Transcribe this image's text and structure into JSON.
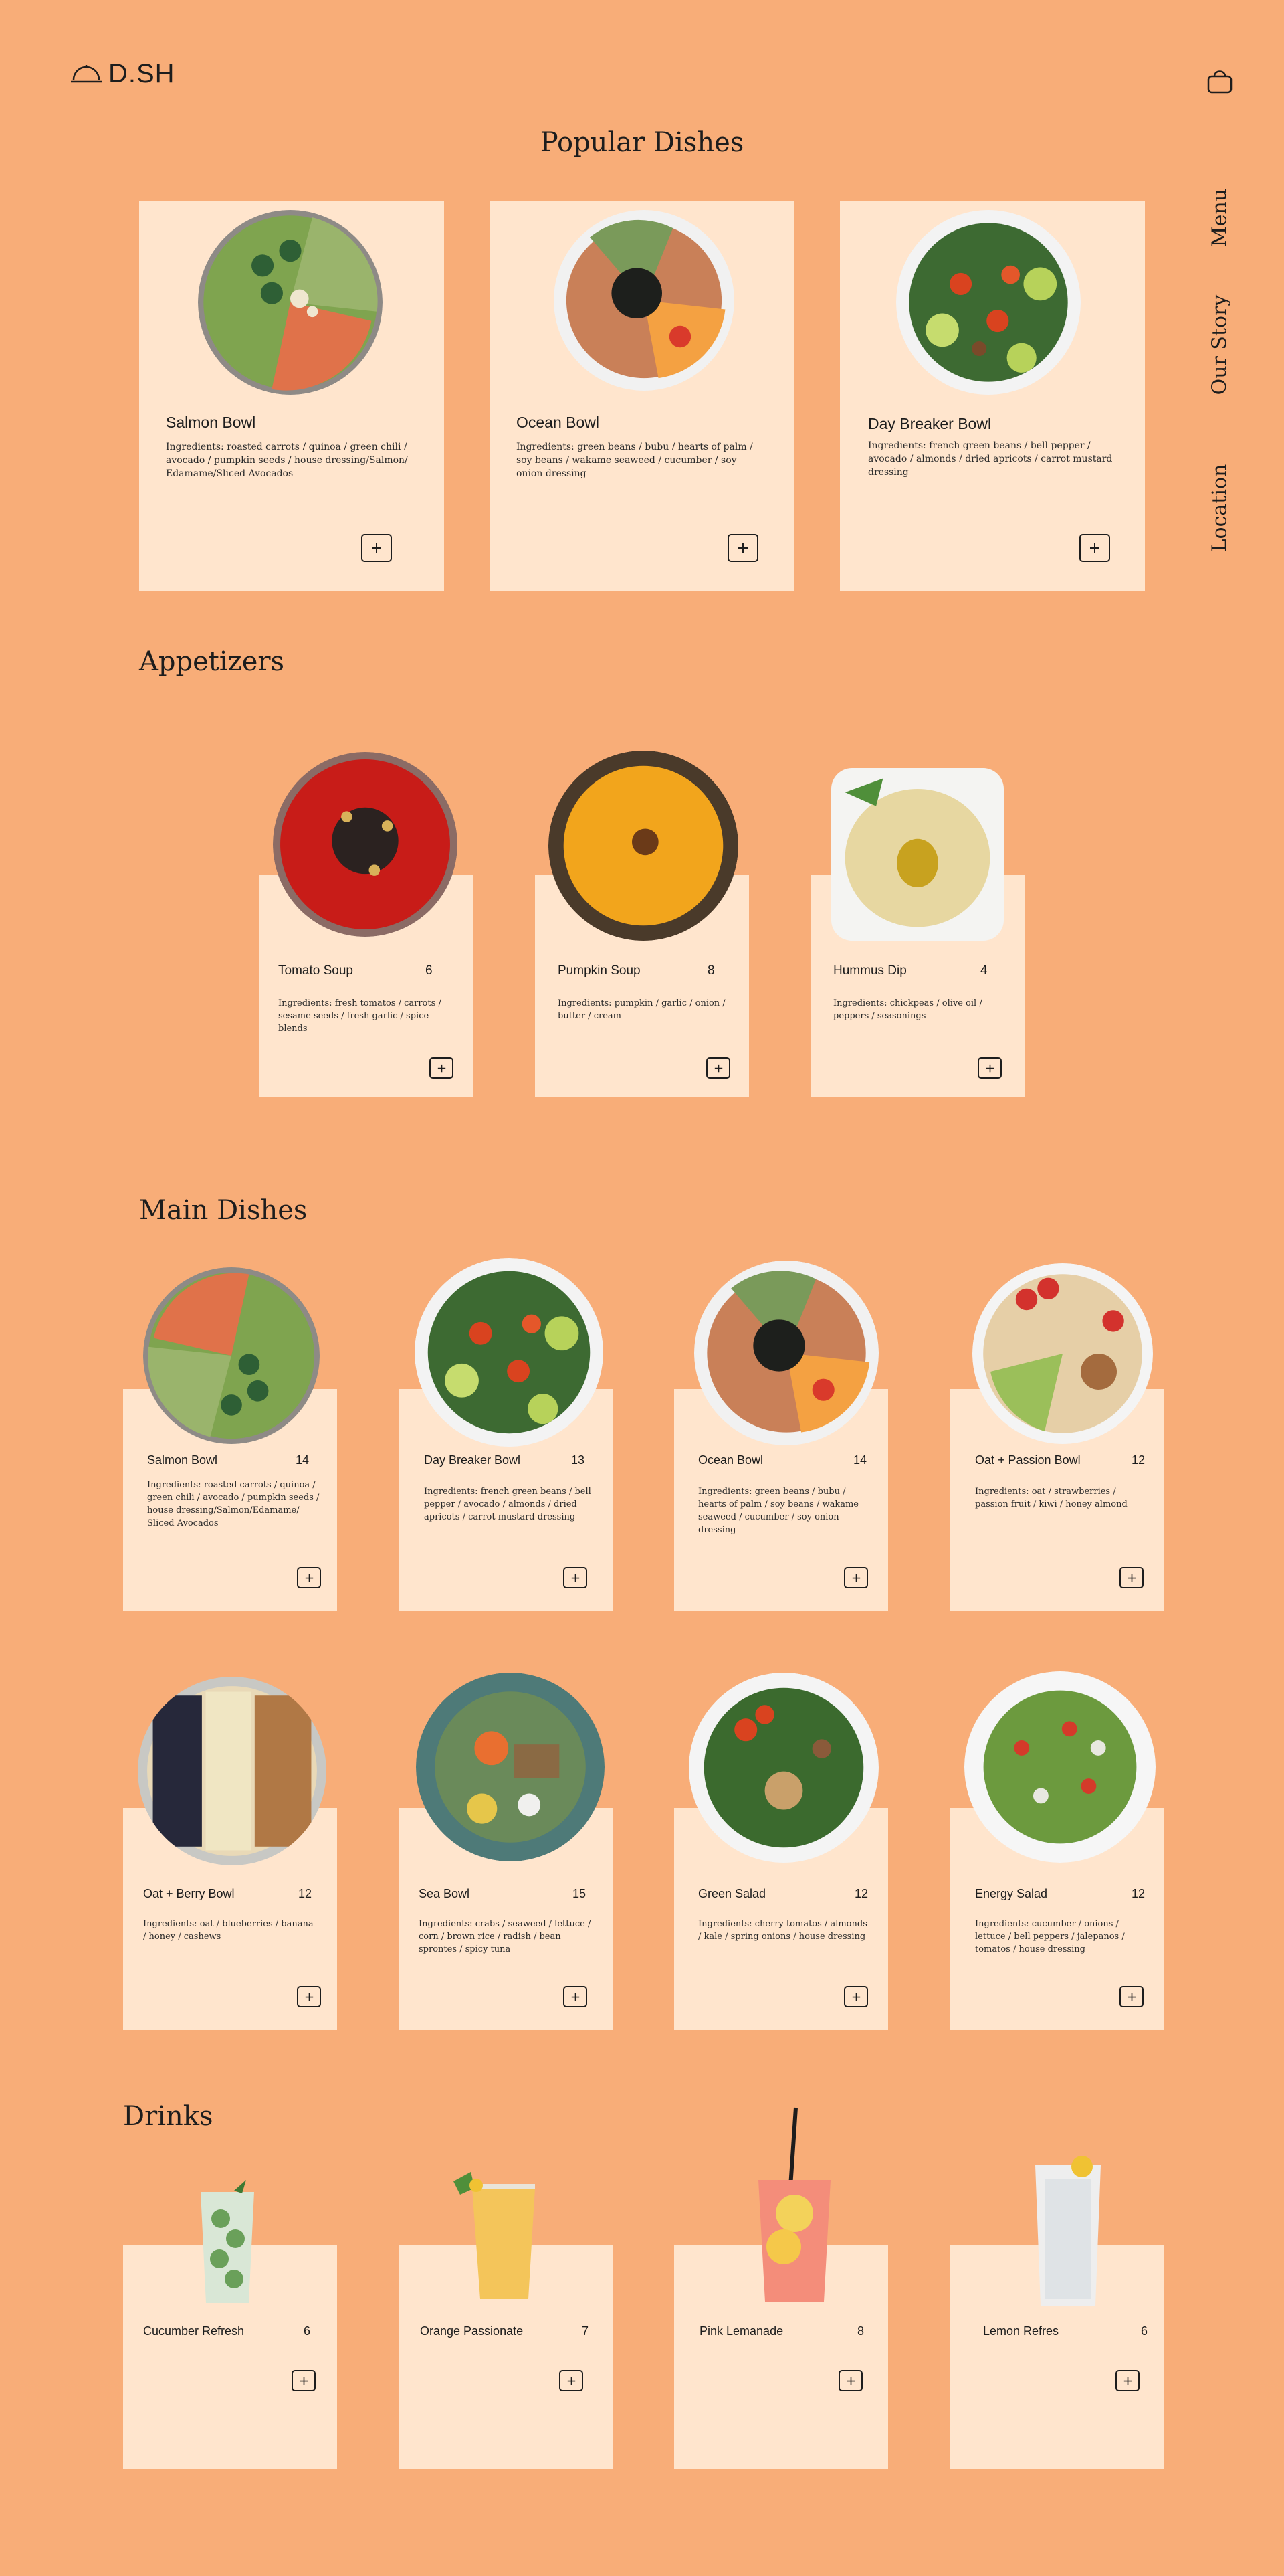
{
  "header": {
    "brand": "D.SH",
    "logo_icon": "cloche-icon",
    "cart_icon": "basket-icon"
  },
  "side_nav": [
    "Menu",
    "Our Story",
    "Location"
  ],
  "popular": {
    "title": "Popular Dishes",
    "items": [
      {
        "name": "Salmon Bowl",
        "ingredients": "Ingredients: roasted carrots / quinoa / green chili / avocado / pumpkin seeds / house dressing/Salmon/ Edamame/Sliced Avocados"
      },
      {
        "name": "Ocean Bowl",
        "ingredients": "Ingredients: green beans / bubu / hearts of palm / soy beans / wakame seaweed / cucumber / soy onion dressing"
      },
      {
        "name": "Day Breaker Bowl",
        "ingredients": "Ingredients: french green beans / bell pepper / avocado / almonds / dried apricots / carrot mustard dressing"
      }
    ]
  },
  "appetizers": {
    "title": "Appetizers",
    "items": [
      {
        "name": "Tomato Soup",
        "price": "6",
        "ingredients": "Ingredients: fresh tomatos / carrots / sesame seeds / fresh garlic / spice blends"
      },
      {
        "name": "Pumpkin Soup",
        "price": "8",
        "ingredients": "Ingredients: pumpkin / garlic / onion / butter / cream"
      },
      {
        "name": "Hummus Dip",
        "price": "4",
        "ingredients": "Ingredients: chickpeas / olive oil / peppers / seasonings"
      }
    ]
  },
  "main": {
    "title": "Main Dishes",
    "items": [
      {
        "name": "Salmon Bowl",
        "price": "14",
        "ingredients": "Ingredients: roasted carrots / quinoa / green chili / avocado / pumpkin seeds / house dressing/Salmon/Edamame/ Sliced Avocados"
      },
      {
        "name": "Day Breaker Bowl",
        "price": "13",
        "ingredients": "Ingredients: french green beans / bell pepper / avocado / almonds / dried apricots / carrot mustard dressing"
      },
      {
        "name": "Ocean Bowl",
        "price": "14",
        "ingredients": "Ingredients: green beans / bubu / hearts of palm / soy beans / wakame seaweed / cucumber / soy onion dressing"
      },
      {
        "name": "Oat + Passion Bowl",
        "price": "12",
        "ingredients": "Ingredients: oat / strawberries / passion fruit / kiwi / honey almond"
      },
      {
        "name": "Oat + Berry Bowl",
        "price": "12",
        "ingredients": "Ingredients: oat / blueberries / banana / honey / cashews"
      },
      {
        "name": "Sea Bowl",
        "price": "15",
        "ingredients": "Ingredients: crabs / seaweed / lettuce / corn / brown rice / radish / bean sprontes / spicy tuna"
      },
      {
        "name": "Green Salad",
        "price": "12",
        "ingredients": "Ingredients: cherry tomatos / almonds / kale / spring onions / house dressing"
      },
      {
        "name": "Energy Salad",
        "price": "12",
        "ingredients": "Ingredients: cucumber / onions / lettuce / bell peppers / jalepanos / tomatos / house dressing"
      }
    ]
  },
  "drinks": {
    "title": "Drinks",
    "items": [
      {
        "name": "Cucumber Refresh",
        "price": "6"
      },
      {
        "name": "Orange Passionate",
        "price": "7"
      },
      {
        "name": "Pink Lemanade",
        "price": "8"
      },
      {
        "name": "Lemon Refres",
        "price": "6"
      }
    ]
  },
  "colors": {
    "background": "#f8ad78",
    "card": "#ffe5cd",
    "text": "#1d1d1d"
  }
}
